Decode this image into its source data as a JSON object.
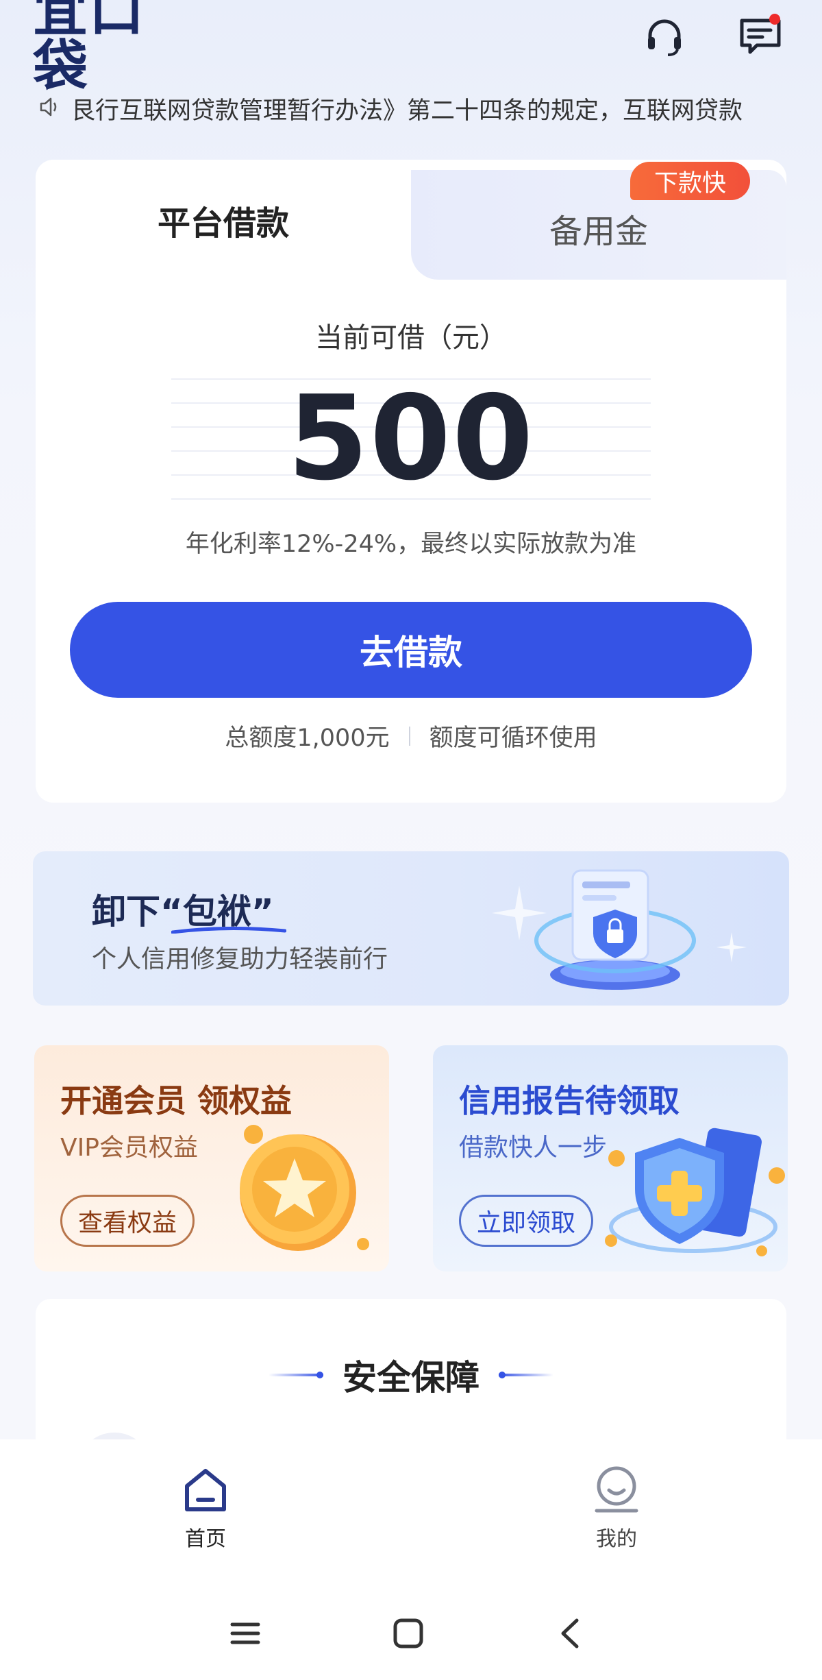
{
  "header": {
    "logo_text": "宜口袋",
    "support_icon": "headset-icon",
    "message_icon": "message-icon",
    "has_unread_message": true
  },
  "notice": {
    "icon": "speaker-icon",
    "text": "艮行互联网贷款管理暂行办法》第二十四条的规定，互联网贷款"
  },
  "loan_card": {
    "tabs": [
      {
        "label": "平台借款",
        "active": true
      },
      {
        "label": "备用金",
        "active": false
      }
    ],
    "fast_badge": "下款快",
    "available_label": "当前可借（元）",
    "amount": "500",
    "rate_text": "年化利率12%-24%，最终以实际放款为准",
    "borrow_button": "去借款",
    "total_quota": "总额度1,000元",
    "quota_note": "额度可循环使用"
  },
  "banner": {
    "title": "卸下“包袱”",
    "subtitle": "个人信用修复助力轻装前行"
  },
  "promos": {
    "left": {
      "title": "开通会员 领权益",
      "subtitle": "VIP会员权益",
      "button": "查看权益"
    },
    "right": {
      "title": "信用报告待领取",
      "subtitle": "借款快人一步",
      "button": "立即领取"
    }
  },
  "security": {
    "title": "安全保障"
  },
  "bottom_nav": {
    "items": [
      {
        "label": "首页",
        "icon": "home-icon",
        "active": true
      },
      {
        "label": "我的",
        "icon": "profile-icon",
        "active": false
      }
    ]
  },
  "colors": {
    "primary": "#3553e5",
    "brand_dark": "#1a2a66",
    "badge": "#f2503a"
  }
}
